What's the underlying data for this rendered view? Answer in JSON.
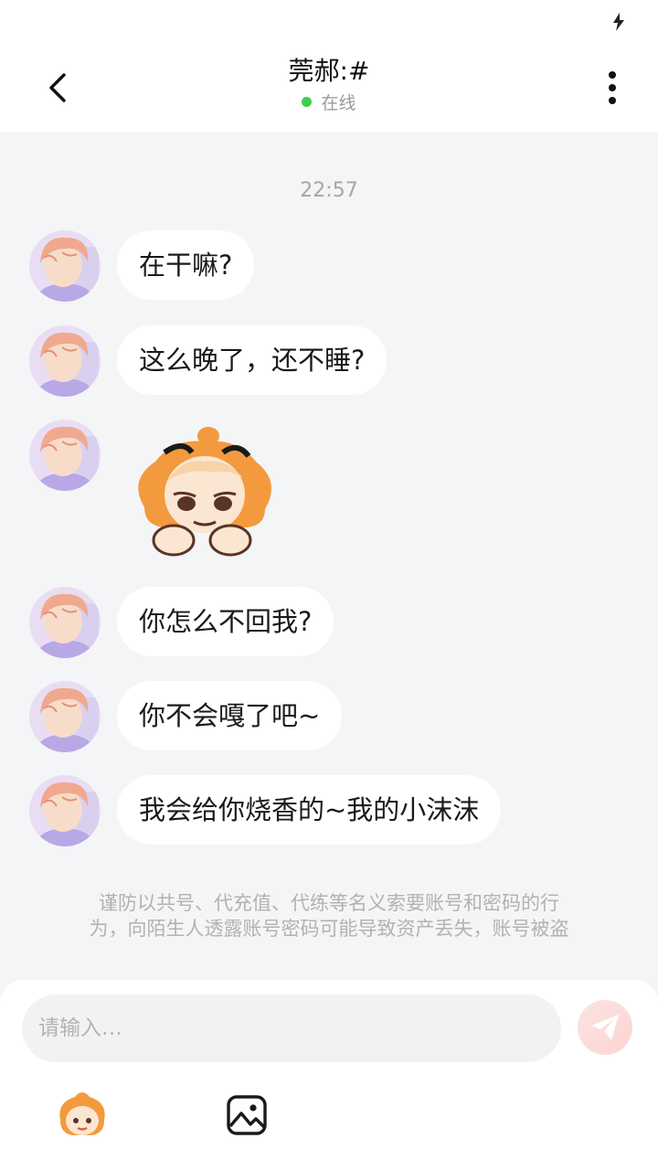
{
  "header": {
    "title": "莞郝:#",
    "presence": "在线",
    "online_color": "#3bd14a",
    "back_icon": "chevron-left-icon",
    "more_icon": "more-vertical-icon"
  },
  "status_bar": {
    "icon": "charging-bolt-icon"
  },
  "chat": {
    "timestamp": "22:57",
    "messages": [
      {
        "type": "text",
        "text": "在干嘛?"
      },
      {
        "type": "text",
        "text": "这么晚了，还不睡?"
      },
      {
        "type": "sticker",
        "sticker": "sulking-cartoon-girl-sticker"
      },
      {
        "type": "text",
        "text": "你怎么不回我?"
      },
      {
        "type": "text",
        "text": "你不会嘎了吧~"
      },
      {
        "type": "text",
        "text": "我会给你烧香的~我的小沫沫"
      }
    ]
  },
  "notice": {
    "line1": "谨防以共号、代充值、代练等名义索要账号和密码的行",
    "line2": "为，向陌生人透露账号密码可能导致资产丢失，账号被盗"
  },
  "composer": {
    "placeholder": "请输入…",
    "send_icon": "send-paper-plane-icon",
    "emoji_icon": "emoji-sticker-icon",
    "image_icon": "image-picker-icon"
  }
}
